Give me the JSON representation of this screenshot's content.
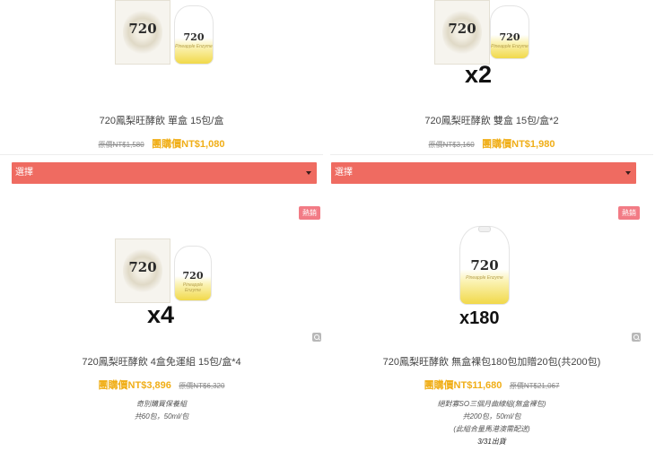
{
  "products": [
    {
      "name": "720鳳梨旺酵飲 單盒 15包/盒",
      "original_price": "原價NT$1,580",
      "group_price": "團購價NT$1,080",
      "select_label": "選擇",
      "image": {
        "logo": "720",
        "script": "Pineapple Enzyme"
      }
    },
    {
      "name": "720鳳梨旺酵飲 雙盒 15包/盒*2",
      "original_price": "原價NT$3,160",
      "group_price": "團購價NT$1,980",
      "select_label": "選擇",
      "image": {
        "logo": "720",
        "script": "Pineapple Enzyme",
        "multiplier": "x2"
      }
    },
    {
      "name": "720鳳梨旺酵飲 4盒免運組 15包/盒*4",
      "original_price": "原價NT$6,320",
      "group_price": "團購價NT$3,896",
      "badge": "熱銷",
      "image": {
        "logo": "720",
        "script": "Pineapple Enzyme",
        "multiplier": "x4"
      },
      "description": [
        "奇別購買保養組",
        "共60包，50ml/包"
      ]
    },
    {
      "name": "720鳳梨旺酵飲 無盒裸包180包加贈20包(共200包)",
      "original_price": "原價NT$21,067",
      "group_price": "團購價NT$11,680",
      "badge": "熱銷",
      "image": {
        "logo": "720",
        "script": "Pineapple Enzyme",
        "multiplier": "x180"
      },
      "description": [
        "絕對寡SO三個月曲線組(無盒裸包)",
        "共200包，50ml/包",
        "(此組合量馬港澳需配送)",
        "3/31出貨"
      ]
    }
  ],
  "icons": {
    "zoom": "magnifier-icon",
    "caret": "caret-down-icon"
  },
  "colors": {
    "select_bar": "#ef6b61",
    "group_price": "#f0ae17",
    "badge": "#f27b85"
  }
}
